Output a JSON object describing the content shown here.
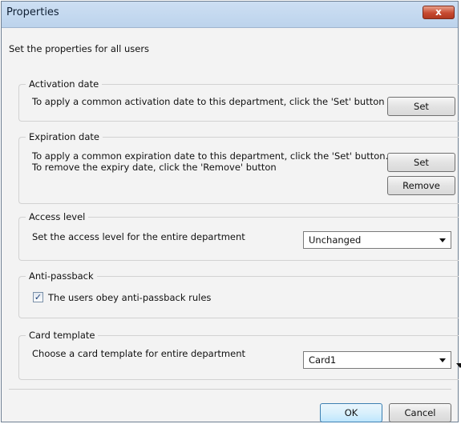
{
  "window": {
    "title": "Properties",
    "close_glyph": "x"
  },
  "subtitle": "Set the properties for all users",
  "activation": {
    "label": "Activation date",
    "text": "To apply a common activation date to this department, click the 'Set' button",
    "set_label": "Set"
  },
  "expiration": {
    "label": "Expiration date",
    "text_line1": "To apply a common expiration date to this department, click the 'Set' button.",
    "text_line2": "To remove the expiry date, click the 'Remove' button",
    "set_label": "Set",
    "remove_label": "Remove"
  },
  "access": {
    "label": "Access level",
    "text": "Set the access level for the entire department",
    "selected": "Unchanged"
  },
  "antipassback": {
    "label": "Anti-passback",
    "checkbox_label": "The users obey anti-passback rules",
    "checked": true,
    "check_glyph": "✓"
  },
  "card": {
    "label": "Card template",
    "text": "Choose a card template for entire department",
    "selected": "Card1"
  },
  "footer": {
    "ok_label": "OK",
    "cancel_label": "Cancel"
  }
}
